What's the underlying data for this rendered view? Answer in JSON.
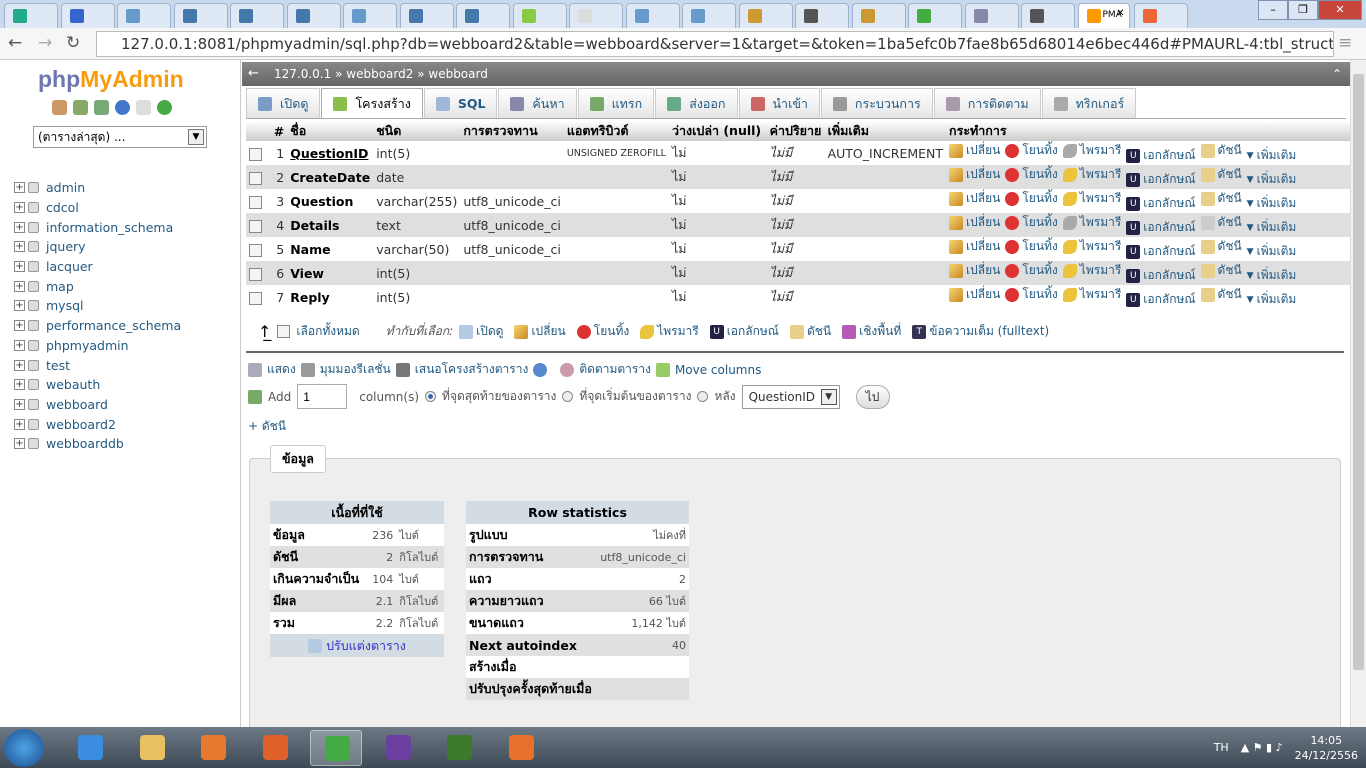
{
  "browser": {
    "url": "127.0.0.1:8081/phpmyadmin/sql.php?db=webboard2&table=webboard&server=1&target=&token=1ba5efc0b7fae8b65d68014e6bec446d#PMAURL-4:tbl_structure.php?",
    "active_tab_title": "PMA",
    "window_controls": [
      "–",
      "❐",
      "✕"
    ]
  },
  "sidebar": {
    "logo_php": "php",
    "logo_myadmin": "MyAdmin",
    "recent_select": "(ตารางล่าสุด) ...",
    "databases": [
      "admin",
      "cdcol",
      "information_schema",
      "jquery",
      "lacquer",
      "map",
      "mysql",
      "performance_schema",
      "phpmyadmin",
      "test",
      "webauth",
      "webboard",
      "webboard2",
      "webboarddb"
    ]
  },
  "breadcrumb": {
    "server": "127.0.0.1",
    "db": "webboard2",
    "table": "webboard",
    "sep": "»"
  },
  "tabs": [
    {
      "label": "เปิดดู",
      "icon": "browse-icon",
      "color": "#7b9bc8"
    },
    {
      "label": "โครงสร้าง",
      "icon": "structure-icon",
      "color": "#8cbf4a",
      "active": true
    },
    {
      "label": "SQL",
      "icon": "sql-icon",
      "color": "#9fb7d8"
    },
    {
      "label": "ค้นหา",
      "icon": "search-icon",
      "color": "#88a"
    },
    {
      "label": "แทรก",
      "icon": "insert-icon",
      "color": "#7a6"
    },
    {
      "label": "ส่งออก",
      "icon": "export-icon",
      "color": "#6a8"
    },
    {
      "label": "นำเข้า",
      "icon": "import-icon",
      "color": "#c66"
    },
    {
      "label": "กระบวนการ",
      "icon": "wrench-icon",
      "color": "#999"
    },
    {
      "label": "การติดตาม",
      "icon": "eye-icon",
      "color": "#a9a"
    },
    {
      "label": "ทริกเกอร์",
      "icon": "trigger-icon",
      "color": "#aaa"
    }
  ],
  "structure": {
    "headers": [
      "#",
      "ชื่อ",
      "ชนิด",
      "การตรวจทาน",
      "แอตทริบิวต์",
      "ว่างเปล่า (null)",
      "ค่าปริยาย",
      "เพิ่มเติม",
      "กระทำการ"
    ],
    "rows": [
      {
        "n": "1",
        "name": "QuestionID",
        "type": "int(5)",
        "collation": "",
        "attributes": "UNSIGNED ZEROFILL",
        "null": "ไม่",
        "default": "ไม่มี",
        "extra": "AUTO_INCREMENT",
        "pk": true
      },
      {
        "n": "2",
        "name": "CreateDate",
        "type": "date",
        "collation": "",
        "attributes": "",
        "null": "ไม่",
        "default": "ไม่มี",
        "extra": ""
      },
      {
        "n": "3",
        "name": "Question",
        "type": "varchar(255)",
        "collation": "utf8_unicode_ci",
        "attributes": "",
        "null": "ไม่",
        "default": "ไม่มี",
        "extra": ""
      },
      {
        "n": "4",
        "name": "Details",
        "type": "text",
        "collation": "utf8_unicode_ci",
        "attributes": "",
        "null": "ไม่",
        "default": "ไม่มี",
        "extra": "",
        "text": true
      },
      {
        "n": "5",
        "name": "Name",
        "type": "varchar(50)",
        "collation": "utf8_unicode_ci",
        "attributes": "",
        "null": "ไม่",
        "default": "ไม่มี",
        "extra": ""
      },
      {
        "n": "6",
        "name": "View",
        "type": "int(5)",
        "collation": "",
        "attributes": "",
        "null": "ไม่",
        "default": "ไม่มี",
        "extra": ""
      },
      {
        "n": "7",
        "name": "Reply",
        "type": "int(5)",
        "collation": "",
        "attributes": "",
        "null": "ไม่",
        "default": "ไม่มี",
        "extra": ""
      }
    ],
    "actions": [
      "เปลี่ยน",
      "โยนทิ้ง",
      "ไพรมารี",
      "เอกลักษณ์",
      "ดัชนี",
      "เพิ่มเติม"
    ]
  },
  "selection": {
    "check_all": "เลือกทั้งหมด",
    "with_selected": "ทำกับที่เลือก:",
    "browse": "เปิดดู",
    "change": "เปลี่ยน",
    "drop": "โยนทิ้ง",
    "primary": "ไพรมารี",
    "unique": "เอกลักษณ์",
    "index": "ดัชนี",
    "spatial": "เชิงพื้นที่",
    "fulltext": "ข้อความเต็ม (fulltext)"
  },
  "links": {
    "print": "แสดง",
    "relation": "มุมมองรีเลชั่น",
    "propose": "เสนอโครงสร้างตาราง",
    "track": "ติดตามตาราง",
    "move": "Move columns"
  },
  "add_column": {
    "label": "Add",
    "count": "1",
    "unit": "column(s)",
    "at_end": "ที่จุดสุดท้ายของตาราง",
    "at_start": "ที่จุดเริ่มต้นของตาราง",
    "after": "หลัง",
    "after_field": "QuestionID",
    "go": "ไป",
    "selected": "at_end"
  },
  "add_index": "+ ดัชนี",
  "info": {
    "legend": "ข้อมูล",
    "space": {
      "title": "เนื้อที่ที่ใช้",
      "rows": [
        [
          "ข้อมูล",
          "236",
          "ไบต์"
        ],
        [
          "ดัชนี",
          "2",
          "กิโลไบต์"
        ],
        [
          "เกินความจำเป็น",
          "104",
          "ไบต์"
        ],
        [
          "มีผล",
          "2.1",
          "กิโลไบต์"
        ],
        [
          "รวม",
          "2.2",
          "กิโลไบต์"
        ]
      ],
      "optimize": "ปรับแต่งตาราง"
    },
    "rowstats": {
      "title": "Row statistics",
      "rows": [
        [
          "รูปแบบ",
          "ไม่คงที่"
        ],
        [
          "การตรวจทาน",
          "utf8_unicode_ci"
        ],
        [
          "แถว",
          "2"
        ],
        [
          "ความยาวแถว",
          "66 ไบต์"
        ],
        [
          "ขนาดแถว",
          "1,142 ไบต์"
        ],
        [
          "Next autoindex",
          "40"
        ],
        [
          "สร้างเมื่อ",
          ""
        ],
        [
          "ปรับปรุงครั้งสุดท้ายเมื่อ",
          ""
        ]
      ]
    }
  },
  "taskbar": {
    "lang": "TH",
    "time": "14:05",
    "date": "24/12/2556"
  }
}
